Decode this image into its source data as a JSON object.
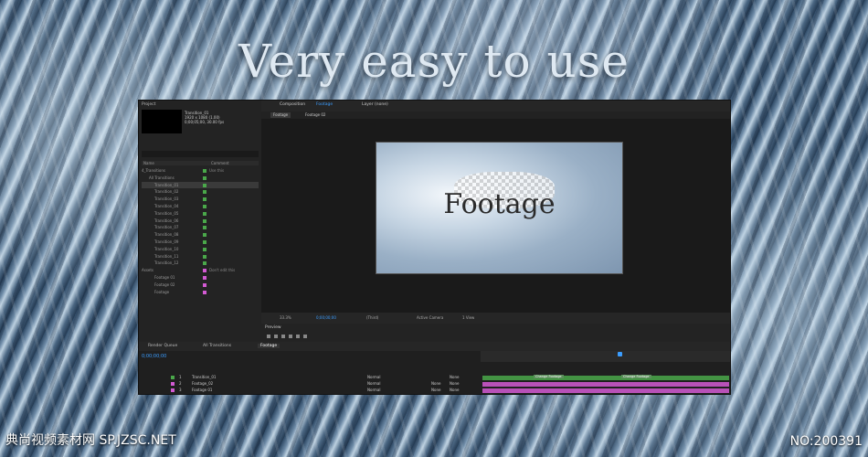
{
  "headline": "Very easy to use",
  "project_panel": {
    "title": "Project",
    "selected_item_name": "Transition_01",
    "selected_item_info": [
      "1920 x 1080 (1.00)",
      "0;00;05;00, 30.00 fps"
    ],
    "columns": [
      "Name",
      "Comment"
    ],
    "items": [
      {
        "name": "4_Transitions",
        "color": "#4aa84a",
        "comment": "Use this"
      },
      {
        "name": "All Transitions",
        "color": "#4aa84a",
        "comment": ""
      },
      {
        "name": "Transition_01",
        "color": "#4aa84a",
        "comment": "",
        "selected": true
      },
      {
        "name": "Transition_02",
        "color": "#4aa84a",
        "comment": ""
      },
      {
        "name": "Transition_03",
        "color": "#4aa84a",
        "comment": ""
      },
      {
        "name": "Transition_04",
        "color": "#4aa84a",
        "comment": ""
      },
      {
        "name": "Transition_05",
        "color": "#4aa84a",
        "comment": ""
      },
      {
        "name": "Transition_06",
        "color": "#4aa84a",
        "comment": ""
      },
      {
        "name": "Transition_07",
        "color": "#4aa84a",
        "comment": ""
      },
      {
        "name": "Transition_08",
        "color": "#4aa84a",
        "comment": ""
      },
      {
        "name": "Transition_09",
        "color": "#4aa84a",
        "comment": ""
      },
      {
        "name": "Transition_10",
        "color": "#4aa84a",
        "comment": ""
      },
      {
        "name": "Transition_11",
        "color": "#4aa84a",
        "comment": ""
      },
      {
        "name": "Transition_12",
        "color": "#4aa84a",
        "comment": ""
      },
      {
        "name": "Assets",
        "color": "#d35ad3",
        "comment": "Don't edit this"
      },
      {
        "name": "Footage 01",
        "color": "#d35ad3",
        "comment": ""
      },
      {
        "name": "Footage 02",
        "color": "#d35ad3",
        "comment": ""
      },
      {
        "name": "Footage",
        "color": "#d35ad3",
        "comment": ""
      }
    ]
  },
  "viewer": {
    "tabs": [
      "Composition",
      "Footage",
      "Layer (none)"
    ],
    "subtabs": [
      "Footage",
      "Footage 02"
    ],
    "frame_text": "Footage",
    "toolbar": [
      "33.3%",
      "0;00;00;00",
      "(Third)",
      "Active Camera",
      "1 View"
    ]
  },
  "preview_panel": {
    "title": "Preview"
  },
  "timeline": {
    "tabs": [
      "Render Queue",
      "All Transitions",
      "Footage"
    ],
    "timecode": "0;00;00;00",
    "layers": [
      {
        "num": "1",
        "name": "Transition_01",
        "mode": "Normal",
        "trkmat": "",
        "parent": "None",
        "color": "#4aa84a"
      },
      {
        "num": "2",
        "name": "Footage_02",
        "mode": "Normal",
        "trkmat": "None",
        "parent": "None",
        "color": "#d35ad3"
      },
      {
        "num": "3",
        "name": "Footage 01",
        "mode": "Normal",
        "trkmat": "None",
        "parent": "None",
        "color": "#d35ad3"
      }
    ],
    "markers": [
      "Change Footage",
      "Change Footage"
    ]
  },
  "watermark_left": "典尚视频素材网 SP.JZSC.NET",
  "watermark_right": "NO:200391"
}
